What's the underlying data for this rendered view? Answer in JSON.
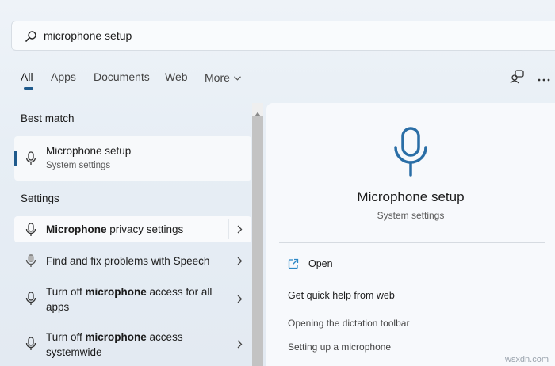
{
  "search": {
    "query": "microphone setup"
  },
  "tabs": [
    {
      "label": "All",
      "active": true
    },
    {
      "label": "Apps",
      "active": false
    },
    {
      "label": "Documents",
      "active": false
    },
    {
      "label": "Web",
      "active": false
    },
    {
      "label": "More",
      "active": false
    }
  ],
  "best_match": {
    "heading": "Best match",
    "title": "Microphone setup",
    "subtitle": "System settings"
  },
  "settings": {
    "heading": "Settings",
    "items": [
      {
        "pre": "",
        "bold": "Microphone",
        "post": " privacy settings",
        "line2": ""
      },
      {
        "pre": "Find and fix problems with Speech",
        "bold": "",
        "post": "",
        "line2": ""
      },
      {
        "pre": "Turn off ",
        "bold": "microphone",
        "post": " access for all",
        "line2": "apps"
      },
      {
        "pre": "Turn off ",
        "bold": "microphone",
        "post": " access",
        "line2": "systemwide"
      }
    ]
  },
  "detail": {
    "title": "Microphone setup",
    "subtitle": "System settings",
    "open_label": "Open",
    "help_label": "Get quick help from web",
    "links": [
      "Opening the dictation toolbar",
      "Setting up a microphone"
    ]
  },
  "watermark": "wsxdn.com",
  "colors": {
    "accent": "#1f5a8c",
    "mic_blue": "#2a6ea6",
    "open_icon": "#2b88c6"
  },
  "icons": [
    "search-icon",
    "chevron-down-icon",
    "people-share-icon",
    "more-icon",
    "microphone-icon",
    "speech-troubleshoot-icon",
    "chevron-right-icon",
    "open-external-icon"
  ]
}
